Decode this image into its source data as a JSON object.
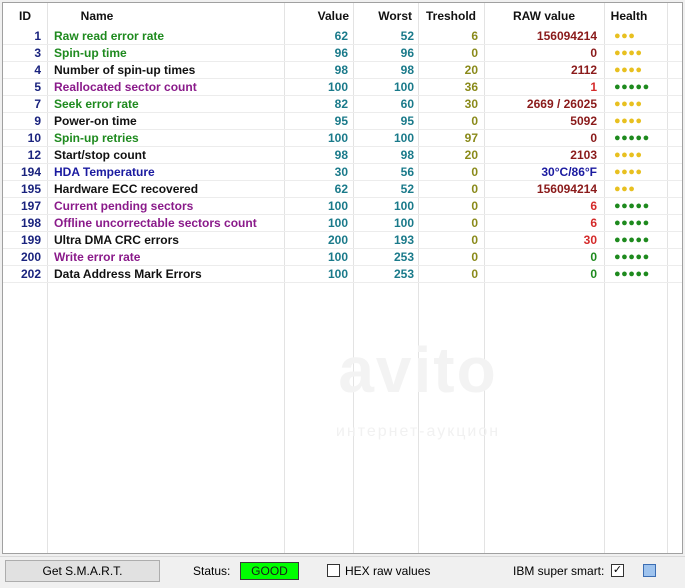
{
  "columns": {
    "id": "ID",
    "name": "Name",
    "value": "Value",
    "worst": "Worst",
    "threshold": "Treshold",
    "raw": "RAW value",
    "health": "Health"
  },
  "colors": {
    "green": "#1e8a1e",
    "black": "#111111",
    "purple": "#8a1a8a",
    "blue": "#1a1aa0",
    "teal": "#1a7a8a",
    "olive": "#8a8a1a",
    "darkred": "#8a1a1a",
    "red": "#d42a2a",
    "dotYellow": "#e8c020",
    "dotGreen": "#1e8a1e"
  },
  "rows": [
    {
      "id": "1",
      "name": "Raw read error rate",
      "nameColor": "green",
      "value": "62",
      "worst": "52",
      "threshold": "6",
      "raw": "156094214",
      "rawColor": "darkred",
      "health": "●●●",
      "healthColor": "dotYellow"
    },
    {
      "id": "3",
      "name": "Spin-up time",
      "nameColor": "green",
      "value": "96",
      "worst": "96",
      "threshold": "0",
      "raw": "0",
      "rawColor": "darkred",
      "health": "●●●●",
      "healthColor": "dotYellow"
    },
    {
      "id": "4",
      "name": "Number of spin-up times",
      "nameColor": "black",
      "value": "98",
      "worst": "98",
      "threshold": "20",
      "raw": "2112",
      "rawColor": "darkred",
      "health": "●●●●",
      "healthColor": "dotYellow"
    },
    {
      "id": "5",
      "name": "Reallocated sector count",
      "nameColor": "purple",
      "value": "100",
      "worst": "100",
      "threshold": "36",
      "raw": "1",
      "rawColor": "red",
      "health": "●●●●●",
      "healthColor": "dotGreen"
    },
    {
      "id": "7",
      "name": "Seek error rate",
      "nameColor": "green",
      "value": "82",
      "worst": "60",
      "threshold": "30",
      "raw": "2669 / 26025",
      "rawColor": "darkred",
      "health": "●●●●",
      "healthColor": "dotYellow"
    },
    {
      "id": "9",
      "name": "Power-on time",
      "nameColor": "black",
      "value": "95",
      "worst": "95",
      "threshold": "0",
      "raw": "5092",
      "rawColor": "darkred",
      "health": "●●●●",
      "healthColor": "dotYellow"
    },
    {
      "id": "10",
      "name": "Spin-up retries",
      "nameColor": "green",
      "value": "100",
      "worst": "100",
      "threshold": "97",
      "raw": "0",
      "rawColor": "darkred",
      "health": "●●●●●",
      "healthColor": "dotGreen"
    },
    {
      "id": "12",
      "name": "Start/stop count",
      "nameColor": "black",
      "value": "98",
      "worst": "98",
      "threshold": "20",
      "raw": "2103",
      "rawColor": "darkred",
      "health": "●●●●",
      "healthColor": "dotYellow"
    },
    {
      "id": "194",
      "name": "HDA Temperature",
      "nameColor": "blue",
      "value": "30",
      "worst": "56",
      "threshold": "0",
      "raw": "30°C/86°F",
      "rawColor": "blue",
      "health": "●●●●",
      "healthColor": "dotYellow"
    },
    {
      "id": "195",
      "name": "Hardware ECC recovered",
      "nameColor": "black",
      "value": "62",
      "worst": "52",
      "threshold": "0",
      "raw": "156094214",
      "rawColor": "darkred",
      "health": "●●●",
      "healthColor": "dotYellow"
    },
    {
      "id": "197",
      "name": "Current pending sectors",
      "nameColor": "purple",
      "value": "100",
      "worst": "100",
      "threshold": "0",
      "raw": "6",
      "rawColor": "red",
      "health": "●●●●●",
      "healthColor": "dotGreen"
    },
    {
      "id": "198",
      "name": "Offline uncorrectable sectors count",
      "nameColor": "purple",
      "value": "100",
      "worst": "100",
      "threshold": "0",
      "raw": "6",
      "rawColor": "red",
      "health": "●●●●●",
      "healthColor": "dotGreen"
    },
    {
      "id": "199",
      "name": "Ultra DMA CRC errors",
      "nameColor": "black",
      "value": "200",
      "worst": "193",
      "threshold": "0",
      "raw": "30",
      "rawColor": "red",
      "health": "●●●●●",
      "healthColor": "dotGreen"
    },
    {
      "id": "200",
      "name": "Write error rate",
      "nameColor": "purple",
      "value": "100",
      "worst": "253",
      "threshold": "0",
      "raw": "0",
      "rawColor": "green",
      "health": "●●●●●",
      "healthColor": "dotGreen"
    },
    {
      "id": "202",
      "name": "Data Address Mark Errors",
      "nameColor": "black",
      "value": "100",
      "worst": "253",
      "threshold": "0",
      "raw": "0",
      "rawColor": "green",
      "health": "●●●●●",
      "healthColor": "dotGreen"
    }
  ],
  "toolbar": {
    "get_smart_label": "Get S.M.A.R.T.",
    "status_label": "Status:",
    "status_value": "GOOD",
    "hex_label": "HEX raw values",
    "ibm_label": "IBM super smart:",
    "ibm_checked": "✓"
  }
}
